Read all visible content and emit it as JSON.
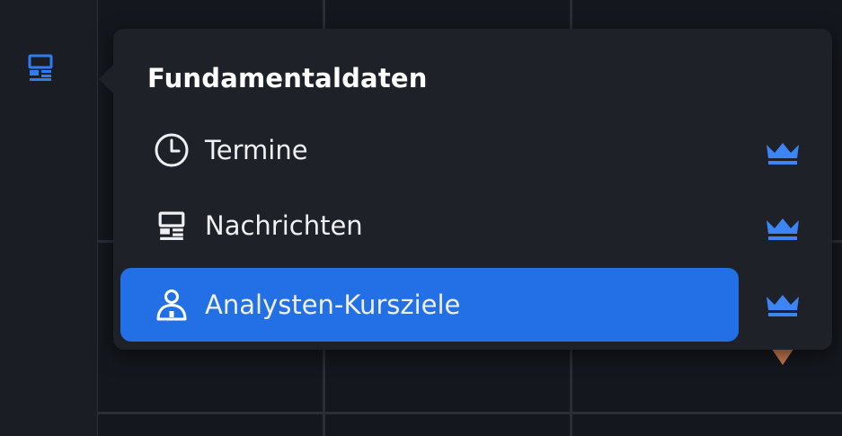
{
  "sidebar": {
    "button": {
      "icon": "news-icon",
      "color": "#2d7cf2"
    }
  },
  "popup": {
    "title": "Fundamentaldaten",
    "items": [
      {
        "label": "Termine",
        "icon": "clock-icon",
        "premium": true,
        "active": false
      },
      {
        "label": "Nachrichten",
        "icon": "news-icon",
        "premium": true,
        "active": false
      },
      {
        "label": "Analysten-Kursziele",
        "icon": "analyst-icon",
        "premium": true,
        "active": true
      }
    ]
  },
  "colors": {
    "accent": "#2370e6",
    "crown": "#3d85f5",
    "text": "#eef0f4",
    "marker": "#c97a4d"
  }
}
